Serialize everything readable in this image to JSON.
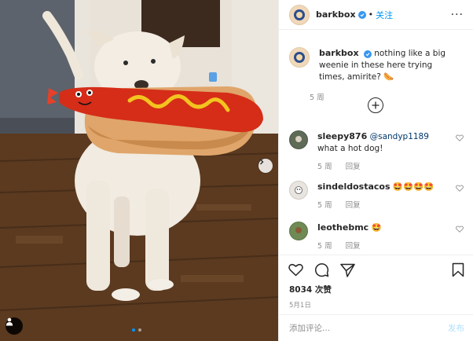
{
  "post": {
    "author": "barkbox",
    "follow_separator": "•",
    "follow_label": "关注",
    "more_label": "···"
  },
  "caption": {
    "username": "barkbox",
    "text": "nothing like a big weenie in these here trying times, amirite? 🌭",
    "age": "5 周"
  },
  "comments": [
    {
      "username": "sleepy876",
      "mention": "@sandyp1189",
      "text": " what a hot dog!",
      "age": "5 周",
      "reply_label": "回复"
    },
    {
      "username": "sindeldostacos",
      "mention": "",
      "text": "🤩🤩🤩🤩",
      "age": "5 周",
      "reply_label": "回复"
    },
    {
      "username": "leothebmc",
      "mention": "",
      "text": "🤩",
      "age": "5 周",
      "reply_label": "回复"
    }
  ],
  "stats": {
    "likes": "8034 次赞",
    "date": "5月1日"
  },
  "composer": {
    "placeholder": "添加评论...",
    "post_label": "发布"
  },
  "colors": {
    "accent": "#0095f6",
    "link": "#00376b",
    "muted": "#8e8e8e"
  },
  "icons": [
    "verified-badge-icon",
    "more-options-icon",
    "load-more-comments-icon",
    "heart-icon",
    "comment-icon",
    "share-icon",
    "bookmark-icon",
    "carousel-next-icon",
    "tagged-user-icon"
  ]
}
